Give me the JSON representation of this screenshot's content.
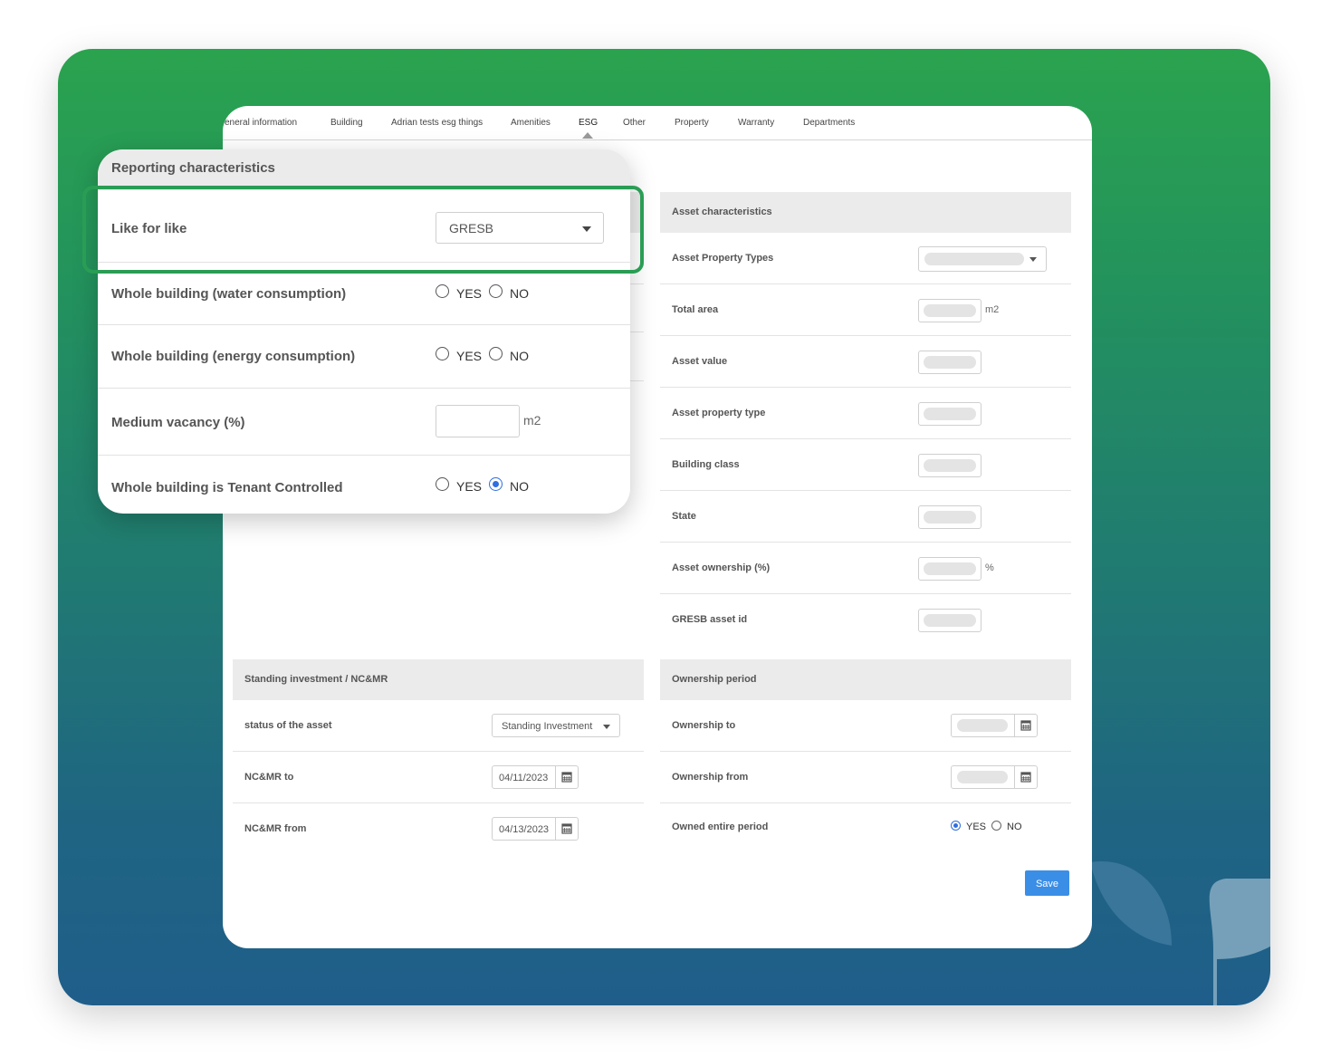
{
  "colors": {
    "accent_green": "#2a9d54",
    "primary_blue": "#3b8ee6",
    "radio_blue": "#2f6fe0"
  },
  "tabs": [
    {
      "label": "eneral information"
    },
    {
      "label": "Building"
    },
    {
      "label": "Adrian tests esg things"
    },
    {
      "label": "Amenities"
    },
    {
      "label": "ESG",
      "active": true
    },
    {
      "label": "Other"
    },
    {
      "label": "Property"
    },
    {
      "label": "Warranty"
    },
    {
      "label": "Departments"
    }
  ],
  "reporting": {
    "title": "Reporting characteristics",
    "like_for_like": {
      "label": "Like for like",
      "value": "GRESB"
    },
    "water": {
      "label": "Whole building (water consumption)",
      "yes": "YES",
      "no": "NO",
      "selected": ""
    },
    "energy": {
      "label": "Whole building (energy consumption)",
      "yes": "YES",
      "no": "NO",
      "selected": ""
    },
    "vacancy": {
      "label": "Medium vacancy (%)",
      "unit": "m2",
      "value": ""
    },
    "tenant": {
      "label": "Whole building is Tenant Controlled",
      "yes": "YES",
      "no": "NO",
      "selected": "NO"
    }
  },
  "asset": {
    "title": "Asset characteristics",
    "property_types": "Asset Property Types",
    "total_area": "Total area",
    "total_area_unit": "m2",
    "asset_value": "Asset value",
    "property_type": "Asset property type",
    "building_class": "Building class",
    "state": "State",
    "ownership": "Asset ownership (%)",
    "ownership_unit": "%",
    "gresb_id": "GRESB asset id"
  },
  "standing": {
    "title": "Standing investment / NC&MR",
    "status_label": "status of the asset",
    "status_value": "Standing Investment",
    "ncmr_to_label": "NC&MR to",
    "ncmr_to_value": "04/11/2023",
    "ncmr_from_label": "NC&MR from",
    "ncmr_from_value": "04/13/2023"
  },
  "ownership_period": {
    "title": "Ownership period",
    "to_label": "Ownership to",
    "from_label": "Ownership from",
    "entire_label": "Owned entire period",
    "yes": "YES",
    "no": "NO",
    "selected": "YES"
  },
  "save_label": "Save"
}
